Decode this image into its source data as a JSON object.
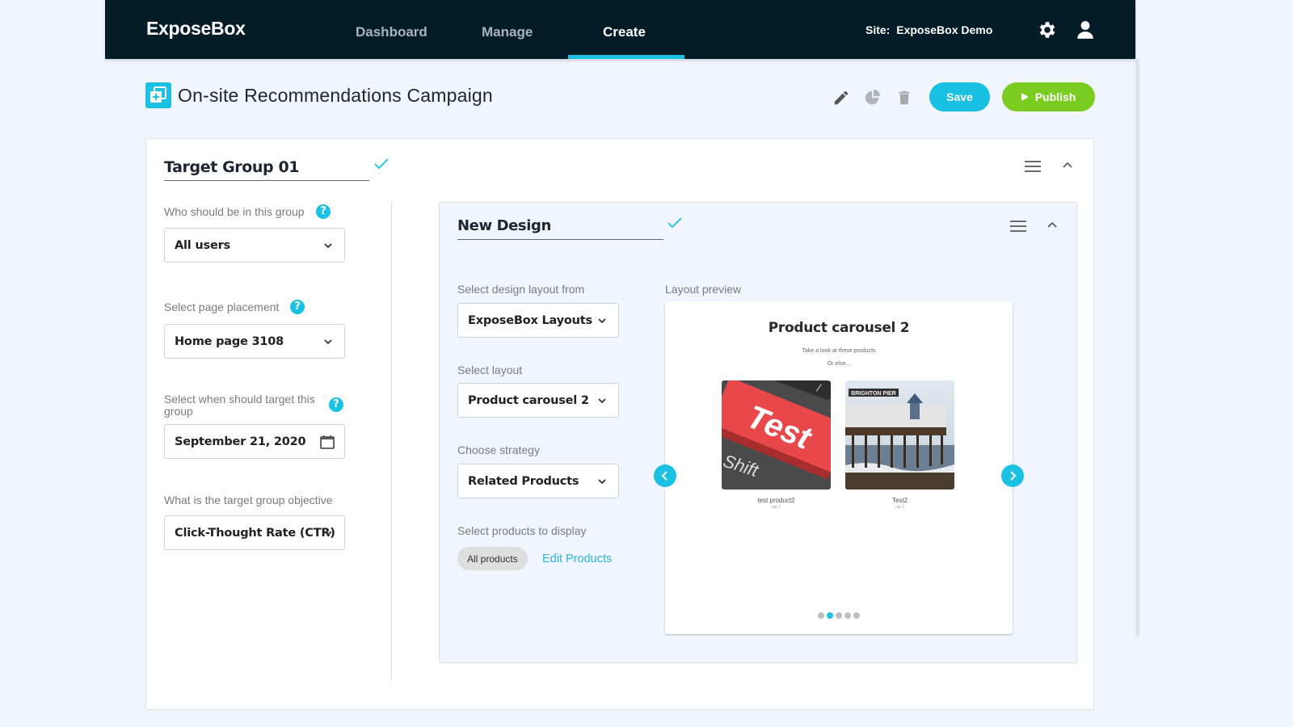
{
  "header": {
    "logo": "ExposeBox",
    "nav": [
      {
        "label": "Dashboard",
        "active": false
      },
      {
        "label": "Manage",
        "active": false
      },
      {
        "label": "Create",
        "active": true
      }
    ],
    "site_label": "Site:",
    "site_name": "ExposeBox Demo",
    "icons": [
      "gear-icon",
      "user-icon"
    ]
  },
  "page": {
    "title": "On-site Recommendations Campaign",
    "toolbar_icons": [
      "pencil-icon",
      "pie-chart-icon",
      "trash-icon"
    ],
    "save_label": "Save",
    "publish_label": "Publish"
  },
  "target_group": {
    "name": "Target Group 01",
    "fields": {
      "who": {
        "label": "Who should be in this group",
        "value": "All users"
      },
      "placement": {
        "label": "Select page placement",
        "value": "Home page 3108"
      },
      "when": {
        "label": "Select when should target this group",
        "value": "September 21, 2020"
      },
      "objective": {
        "label": "What is the target group objective",
        "value": "Click-Thought Rate (CTR)"
      }
    }
  },
  "design": {
    "name": "New Design",
    "layout_source": {
      "label": "Select design layout from",
      "value": "ExposeBox Layouts"
    },
    "layout": {
      "label": "Select layout",
      "value": "Product carousel 2"
    },
    "strategy": {
      "label": "Choose strategy",
      "value": "Related Products"
    },
    "products": {
      "label": "Select products to display",
      "chip": "All products",
      "edit_link": "Edit Products"
    },
    "preview": {
      "label": "Layout preview",
      "title": "Product carousel 2",
      "subtitle": "Take a look at these products",
      "subtitle2": "Or else...",
      "products": [
        {
          "name": "test product2",
          "category": "cat 1",
          "image": "red keyboard key labeled Test"
        },
        {
          "name": "Test2",
          "category": "cat 1",
          "image": "Brighton Pier photo"
        }
      ],
      "dots_total": 5,
      "dots_active_index": 1,
      "accent": "#1bc1e3"
    }
  },
  "colors": {
    "header_bg": "#041c28",
    "accent": "#1bc1e3",
    "publish": "#7acd20",
    "page_bg": "#f1f5fd"
  }
}
